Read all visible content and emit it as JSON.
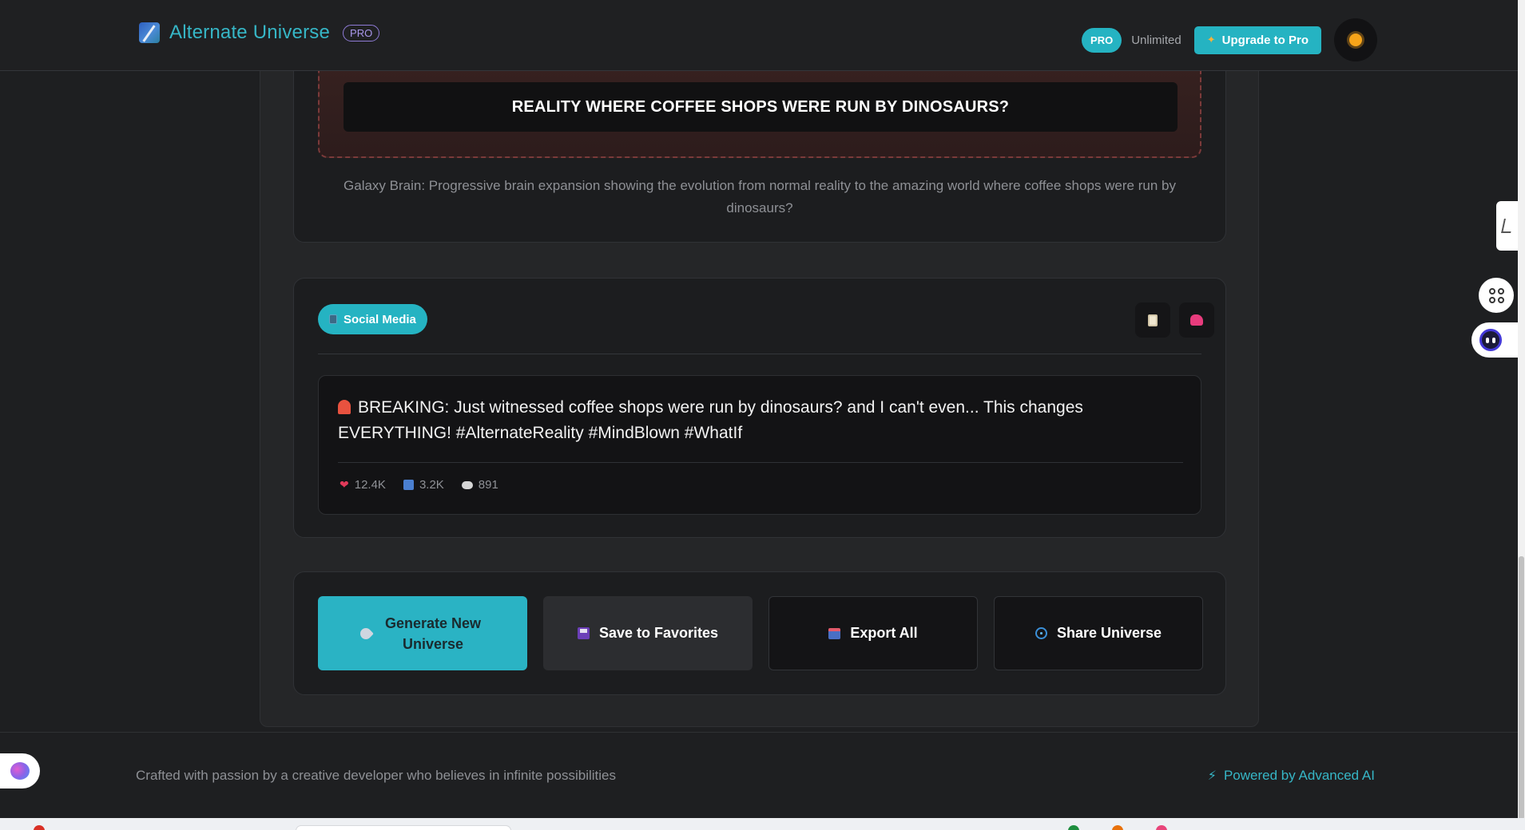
{
  "header": {
    "app_title": "Alternate Universe",
    "pro_tag": "PRO",
    "plan_badge": "PRO",
    "plan_status": "Unlimited",
    "upgrade_label": "Upgrade to Pro"
  },
  "meme": {
    "caption": "REALITY WHERE COFFEE SHOPS WERE RUN BY DINOSAURS?",
    "description": "Galaxy Brain: Progressive brain expansion showing the evolution from normal reality to the amazing world where coffee shops were run by dinosaurs?"
  },
  "social": {
    "chip_label": "Social Media",
    "post_text": "BREAKING: Just witnessed coffee shops were run by dinosaurs? and I can't even... This changes EVERYTHING! #AlternateReality #MindBlown #WhatIf",
    "likes": "12.4K",
    "retweets": "3.2K",
    "comments": "891"
  },
  "actions": {
    "generate_label": "Generate New Universe",
    "save_label": "Save to Favorites",
    "export_label": "Export All",
    "share_label": "Share Universe"
  },
  "footer": {
    "credit": "Crafted with passion by a creative developer who believes in infinite possibilities",
    "powered": "Powered by Advanced AI"
  },
  "colors": {
    "accent": "#25b3c2",
    "background": "#1e1f21",
    "card": "#1c1d1f",
    "pro_outline": "#8e7bd6"
  },
  "icons": {
    "logo": "app-logo-icon",
    "upgrade": "spark-icon",
    "theme": "sun-icon",
    "chip": "mobile-icon",
    "copy": "clipboard-icon",
    "dino": "dinosaur-icon",
    "siren": "siren-icon",
    "like": "heart-icon",
    "retweet": "retweet-icon",
    "comment": "speech-bubble-icon",
    "generate": "rocket-icon",
    "save": "floppy-disk-icon",
    "export": "outbox-icon",
    "share": "globe-icon",
    "powered": "lightning-icon"
  }
}
